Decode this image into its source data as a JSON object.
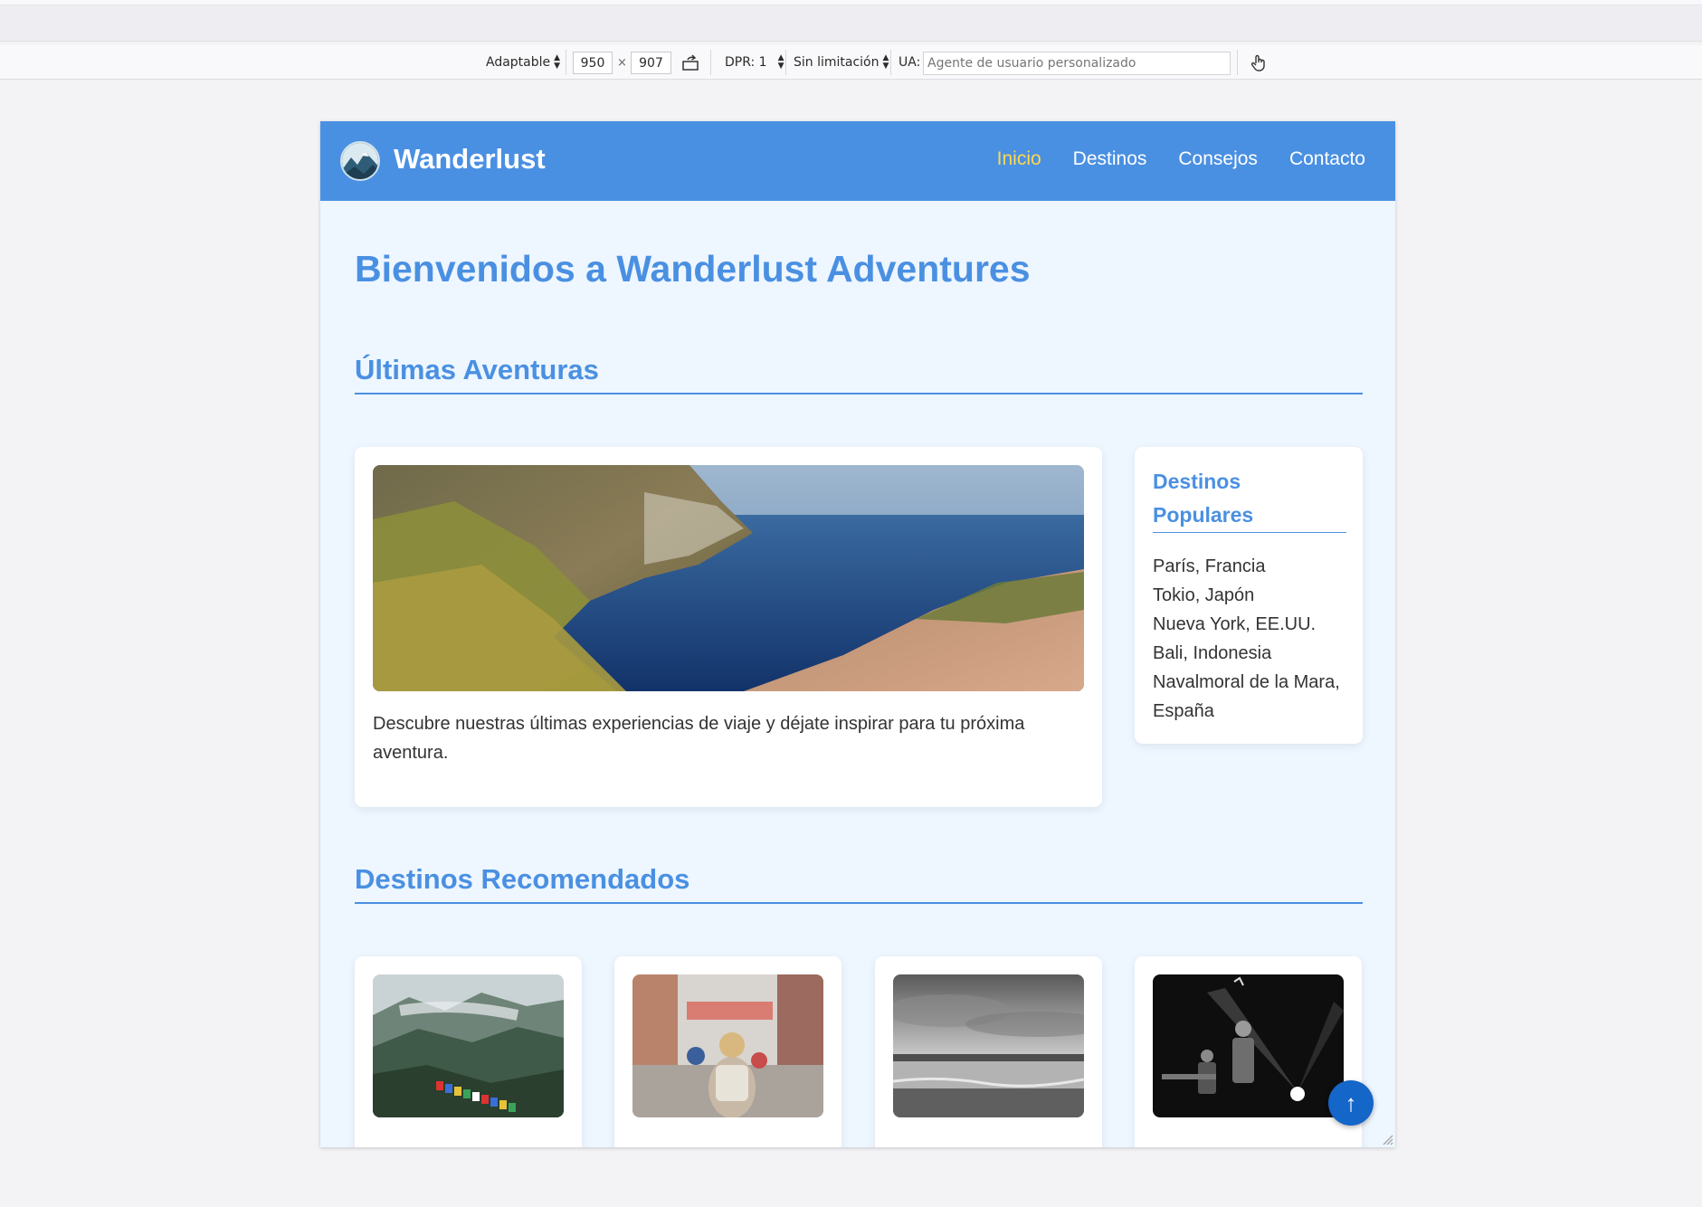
{
  "toolbar": {
    "device": "Adaptable",
    "width": "950",
    "times": "×",
    "height": "907",
    "dpr": "DPR: 1",
    "throttle": "Sin limitación",
    "ua_label": "UA:",
    "ua_placeholder": "Agente de usuario personalizado",
    "icons": [
      "rotate-icon",
      "touch-icon"
    ]
  },
  "site": {
    "brand": "Wanderlust",
    "nav": [
      {
        "label": "Inicio",
        "active": true
      },
      {
        "label": "Destinos",
        "active": false
      },
      {
        "label": "Consejos",
        "active": false
      },
      {
        "label": "Contacto",
        "active": false
      }
    ],
    "heading": "Bienvenidos a Wanderlust Adventures",
    "latest": {
      "title": "Últimas Aventuras",
      "text": "Descubre nuestras últimas experiencias de viaje y déjate inspirar para tu próxima aventura."
    },
    "popular": {
      "title": "Destinos Populares",
      "items": [
        "París, Francia",
        "Tokio, Japón",
        "Nueva York, EE.UU.",
        "Bali, Indonesia",
        "Navalmoral de la Mara, España"
      ]
    },
    "recommended": {
      "title": "Destinos Recomendados"
    },
    "to_top": "↑",
    "colors": {
      "primary": "#4a90e2",
      "nav_active": "#ffd84d",
      "page_bg": "#eef6ff",
      "to_top": "#1466c8"
    }
  }
}
